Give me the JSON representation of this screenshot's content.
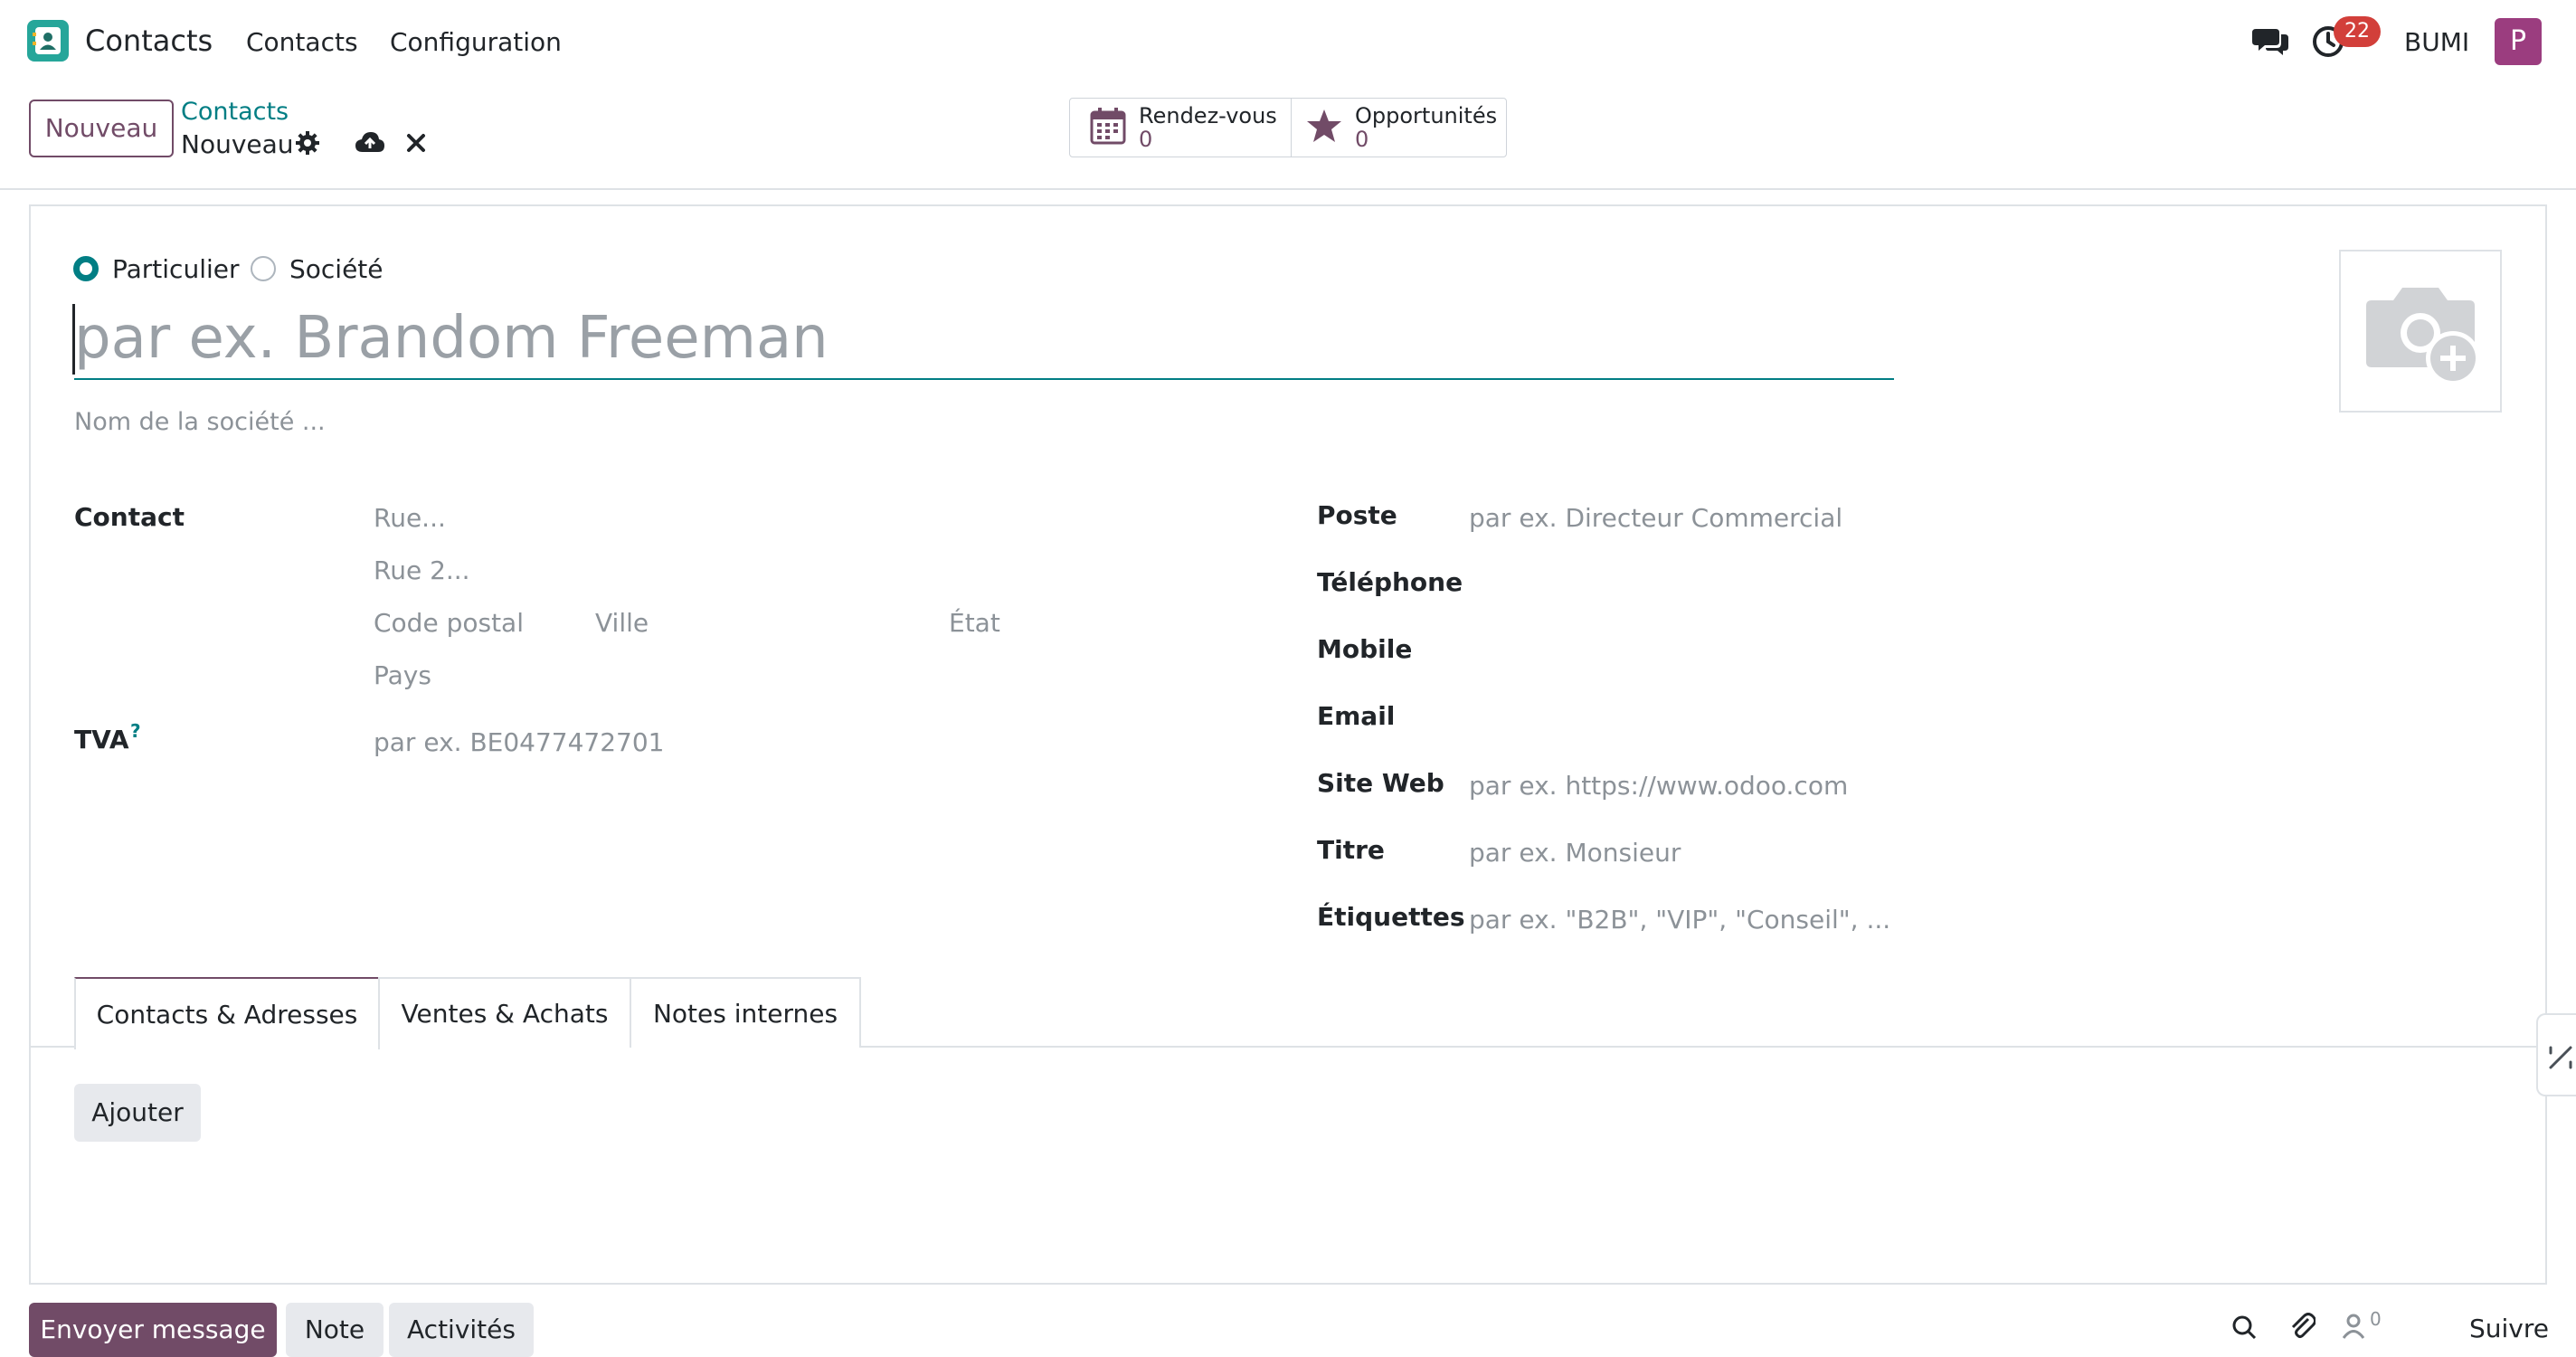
{
  "app": {
    "name": "Contacts",
    "menu": [
      "Contacts",
      "Configuration"
    ],
    "notification_count": "22",
    "company": "BUMI",
    "avatar_letter": "P",
    "accent_color": "#714b67",
    "link_color": "#017e84"
  },
  "control_panel": {
    "new_button": "Nouveau",
    "breadcrumb_parent": "Contacts",
    "breadcrumb_current": "Nouveau",
    "smart_buttons": [
      {
        "label": "Rendez-vous",
        "value": "0",
        "icon": "calendar-icon"
      },
      {
        "label": "Opportunités",
        "value": "0",
        "icon": "star-icon"
      }
    ]
  },
  "form": {
    "company_type_options": [
      "Particulier",
      "Société"
    ],
    "company_type_selected": "Particulier",
    "name_placeholder": "par ex. Brandom Freeman",
    "company_name_placeholder": "Nom de la société ...",
    "left": {
      "contact_label": "Contact",
      "street_placeholder": "Rue...",
      "street2_placeholder": "Rue 2...",
      "zip_placeholder": "Code postal",
      "city_placeholder": "Ville",
      "state_placeholder": "État",
      "country_placeholder": "Pays",
      "vat_label": "TVA",
      "vat_help": "?",
      "vat_placeholder": "par ex. BE0477472701"
    },
    "right": {
      "function_label": "Poste",
      "function_placeholder": "par ex. Directeur Commercial",
      "phone_label": "Téléphone",
      "mobile_label": "Mobile",
      "email_label": "Email",
      "website_label": "Site Web",
      "website_placeholder": "par ex. https://www.odoo.com",
      "title_label": "Titre",
      "title_placeholder": "par ex. Monsieur",
      "tags_label": "Étiquettes",
      "tags_placeholder": "par ex. \"B2B\", \"VIP\", \"Conseil\", ..."
    },
    "tabs": [
      "Contacts & Adresses",
      "Ventes & Achats",
      "Notes internes"
    ],
    "active_tab": "Contacts & Adresses",
    "add_button": "Ajouter"
  },
  "chatter": {
    "send_message": "Envoyer message",
    "note": "Note",
    "activities": "Activités",
    "followers_count": "0",
    "follow": "Suivre"
  }
}
